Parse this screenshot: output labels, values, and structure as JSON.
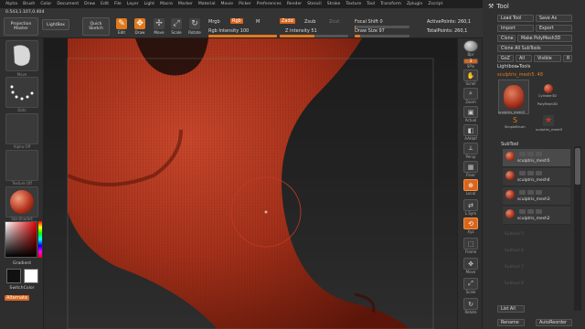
{
  "menu": {
    "items": [
      "Alpha",
      "Brush",
      "Color",
      "Document",
      "Draw",
      "Edit",
      "File",
      "Layer",
      "Light",
      "Macro",
      "Marker",
      "Material",
      "Movie",
      "Picker",
      "Preferences",
      "Render",
      "Stencil",
      "Stroke",
      "Texture",
      "Tool",
      "Transform",
      "Zplugin",
      "Zscript"
    ]
  },
  "toolbar": {
    "coord_readout": "0.543,1.107,0.404",
    "projection_master": "Projection Master",
    "lightbox": "LightBox",
    "quick_sketch": "Quick Sketch",
    "edit": "Edit",
    "draw": "Draw",
    "move": "Move",
    "scale": "Scale",
    "rotate": "Rotate",
    "mrgb": "Mrgb",
    "rgb": "Rgb",
    "m": "M",
    "zadd": "Zadd",
    "zsub": "Zsub",
    "zcut": "Zcut",
    "rgb_intensity_label": "Rgb Intensity 100",
    "z_intensity_label": "Z Intensity 51",
    "focal_shift_label": "Focal Shift 0",
    "draw_size_label": "Draw Size 97",
    "active_points": "ActivePoints: 260,1",
    "total_points": "TotalPoints: 260,1",
    "rgb_intensity": 100,
    "z_intensity": 51,
    "focal_shift": 0,
    "draw_size": 97
  },
  "left_shelf": {
    "brush_label": "Move",
    "stroke_label": "Dots",
    "alpha_label": "Alpha Off",
    "texture_label": "Texture Off",
    "material_label": "SkinShade4",
    "gradient_label": "Gradient",
    "switch_color_label": "SwitchColor",
    "alternate_label": "Alternate"
  },
  "right_shelf": {
    "items": [
      "Bpr",
      "SPix",
      "Scroll",
      "Zoom",
      "Actual",
      "AAHalf",
      "Persp",
      "Floor",
      "Local",
      "L.Sym",
      "Xyz",
      "Frame",
      "Move",
      "Scale",
      "Rotate"
    ],
    "spix_value": "3"
  },
  "tool_panel": {
    "title": "Tool",
    "load_tool": "Load Tool",
    "save_as": "Save As",
    "import": "Import",
    "export": "Export",
    "clone": "Clone",
    "make_polymesh": "Make PolyMesh3D",
    "clone_all": "Clone All SubTools",
    "goz": "GoZ",
    "all": "All",
    "visible": "Visible",
    "r": "R",
    "lightbox_tools": "Lightbox▸Tools",
    "tool_readout": "sculptris_mesh5. 48",
    "thumb1": "sculptris_mesh5",
    "thumb2": "Cylinder3D",
    "thumb3": "PolyMesh3D",
    "thumb4": "SimpleBrush",
    "thumb5": "sculptris_mesh5",
    "subtool": "SubTool",
    "subtools": [
      "sculptris_mesh5",
      "sculptris_mesh4",
      "sculptris_mesh3",
      "sculptris_mesh2"
    ],
    "empty_slots": [
      "Subtool 5",
      "Subtool 6",
      "Subtool 7",
      "Subtool 8"
    ],
    "list_all": "List All",
    "rename": "Rename",
    "auto_reorder": "AutoReorder"
  },
  "colors": {
    "accent": "#e07a1f",
    "clay": "#b5361f",
    "panel": "#303030"
  }
}
